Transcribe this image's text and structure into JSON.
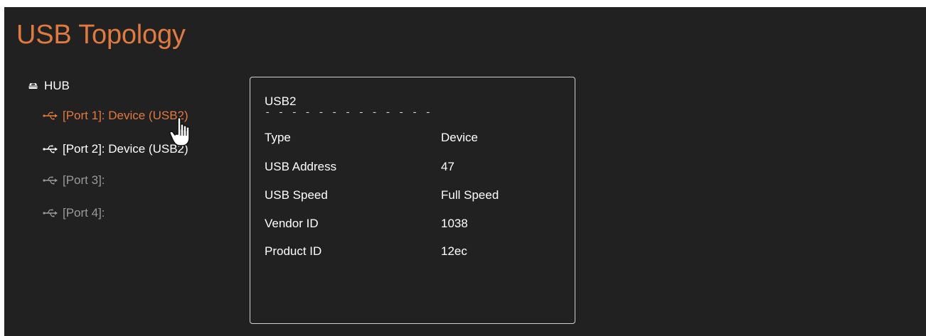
{
  "page": {
    "title": "USB Topology"
  },
  "tree": {
    "hub_icon": "hub-icon",
    "hub_label": "HUB",
    "port_icon": "usb-icon",
    "ports": [
      {
        "label": "[Port 1]: Device (USB2)",
        "state": "selected",
        "color": "#e07a3f"
      },
      {
        "label": "[Port 2]: Device (USB2)",
        "state": "normal",
        "color": "#ffffff"
      },
      {
        "label": "[Port 3]:",
        "state": "empty",
        "color": "#9a9a9a"
      },
      {
        "label": "[Port 4]:",
        "state": "empty",
        "color": "#9a9a9a"
      }
    ]
  },
  "details": {
    "heading": "USB2",
    "divider": "- - - - - - - - - - - - - - - - - - - -",
    "rows": [
      {
        "label": "Type",
        "value": "Device"
      },
      {
        "label": "USB Address",
        "value": "47"
      },
      {
        "label": "USB Speed",
        "value": "Full Speed"
      },
      {
        "label": "Vendor ID",
        "value": "1038"
      },
      {
        "label": "Product ID",
        "value": "12ec"
      }
    ]
  },
  "colors": {
    "accent": "#e07a3f",
    "background": "#212121",
    "text": "#ffffff",
    "muted": "#9a9a9a"
  },
  "cursor": "hand-pointer-icon"
}
